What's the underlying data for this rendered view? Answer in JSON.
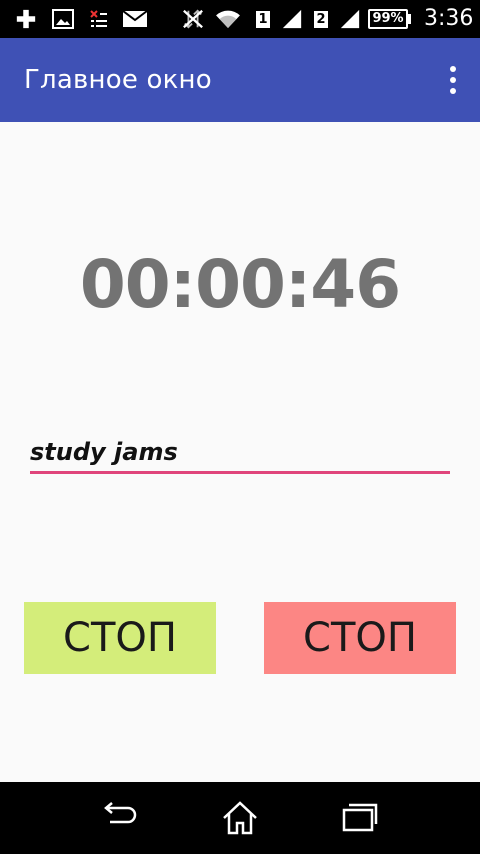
{
  "status_bar": {
    "battery": "99%",
    "time": "3:36",
    "sim1": "1",
    "sim2": "2",
    "icons": [
      "add-notification-icon",
      "image-notification-icon",
      "sms-notification-icon",
      "mail-notification-icon",
      "no-data-icon",
      "wifi-icon",
      "sim1-signal-icon",
      "sim2-signal-icon",
      "battery-icon"
    ]
  },
  "app_bar": {
    "title": "Главное окно",
    "menu_icon": "overflow-menu-icon",
    "color": "#3f51b5"
  },
  "timer": {
    "value": "00:00:46"
  },
  "input": {
    "value": "study jams",
    "underline_color": "#e0457b"
  },
  "buttons": {
    "left": {
      "label": "СТОП",
      "color": "#d4ed7a"
    },
    "right": {
      "label": "СТОП",
      "color": "#fc8684"
    }
  },
  "nav_bar": {
    "icons": [
      "back-icon",
      "home-icon",
      "recents-icon"
    ]
  }
}
